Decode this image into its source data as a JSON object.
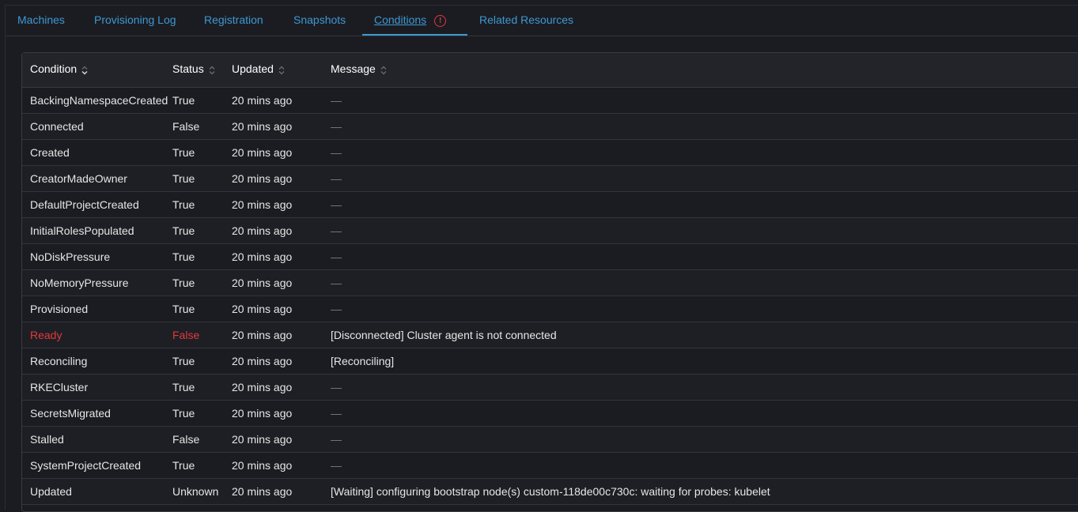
{
  "tabs": [
    {
      "label": "Machines",
      "active": false
    },
    {
      "label": "Provisioning Log",
      "active": false
    },
    {
      "label": "Registration",
      "active": false
    },
    {
      "label": "Snapshots",
      "active": false
    },
    {
      "label": "Conditions",
      "active": true,
      "warning_icon": "exclamation-circle-icon"
    },
    {
      "label": "Related Resources",
      "active": false
    }
  ],
  "table": {
    "columns": [
      {
        "label": "Condition",
        "sort_icon": "sort-icon"
      },
      {
        "label": "Status",
        "sort_icon": "sort-icon"
      },
      {
        "label": "Updated",
        "sort_icon": "sort-icon"
      },
      {
        "label": "Message",
        "sort_icon": "sort-icon"
      }
    ],
    "rows": [
      {
        "condition": "BackingNamespaceCreated",
        "status": "True",
        "updated": "20 mins ago",
        "message": "—",
        "error": false
      },
      {
        "condition": "Connected",
        "status": "False",
        "updated": "20 mins ago",
        "message": "—",
        "error": false
      },
      {
        "condition": "Created",
        "status": "True",
        "updated": "20 mins ago",
        "message": "—",
        "error": false
      },
      {
        "condition": "CreatorMadeOwner",
        "status": "True",
        "updated": "20 mins ago",
        "message": "—",
        "error": false
      },
      {
        "condition": "DefaultProjectCreated",
        "status": "True",
        "updated": "20 mins ago",
        "message": "—",
        "error": false
      },
      {
        "condition": "InitialRolesPopulated",
        "status": "True",
        "updated": "20 mins ago",
        "message": "—",
        "error": false
      },
      {
        "condition": "NoDiskPressure",
        "status": "True",
        "updated": "20 mins ago",
        "message": "—",
        "error": false
      },
      {
        "condition": "NoMemoryPressure",
        "status": "True",
        "updated": "20 mins ago",
        "message": "—",
        "error": false
      },
      {
        "condition": "Provisioned",
        "status": "True",
        "updated": "20 mins ago",
        "message": "—",
        "error": false
      },
      {
        "condition": "Ready",
        "status": "False",
        "updated": "20 mins ago",
        "message": "[Disconnected] Cluster agent is not connected",
        "error": true
      },
      {
        "condition": "Reconciling",
        "status": "True",
        "updated": "20 mins ago",
        "message": "[Reconciling]",
        "error": false
      },
      {
        "condition": "RKECluster",
        "status": "True",
        "updated": "20 mins ago",
        "message": "—",
        "error": false
      },
      {
        "condition": "SecretsMigrated",
        "status": "True",
        "updated": "20 mins ago",
        "message": "—",
        "error": false
      },
      {
        "condition": "Stalled",
        "status": "False",
        "updated": "20 mins ago",
        "message": "—",
        "error": false
      },
      {
        "condition": "SystemProjectCreated",
        "status": "True",
        "updated": "20 mins ago",
        "message": "—",
        "error": false
      },
      {
        "condition": "Updated",
        "status": "Unknown",
        "updated": "20 mins ago",
        "message": "[Waiting] configuring bootstrap node(s) custom-118de00c730c: waiting for probes: kubelet",
        "error": false
      }
    ]
  },
  "colors": {
    "link": "#3d98d3",
    "error": "#e0393e",
    "background": "#1b1c21",
    "header_background": "#232429"
  }
}
